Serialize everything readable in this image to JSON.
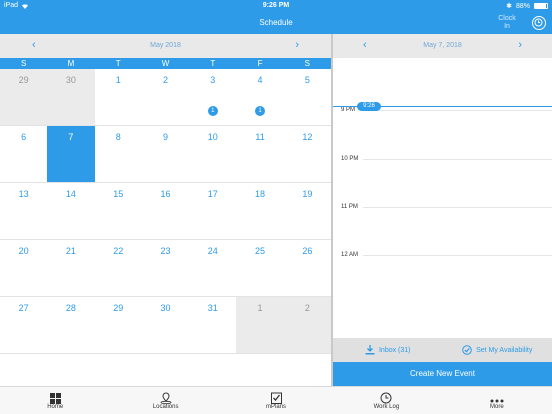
{
  "status": {
    "device": "iPad",
    "time": "9:26 PM",
    "battery": "88%",
    "battery_level": 0.88
  },
  "nav": {
    "title": "Schedule",
    "clock_in": "Clock In"
  },
  "calendar": {
    "month": "May 2018",
    "weekdays": [
      "S",
      "M",
      "T",
      "W",
      "T",
      "F",
      "S"
    ],
    "weeks": [
      [
        {
          "d": "29",
          "other": true
        },
        {
          "d": "30",
          "other": true
        },
        {
          "d": "1"
        },
        {
          "d": "2"
        },
        {
          "d": "3",
          "badge": "1"
        },
        {
          "d": "4",
          "badge": "1"
        },
        {
          "d": "5"
        }
      ],
      [
        {
          "d": "6"
        },
        {
          "d": "7",
          "selected": true
        },
        {
          "d": "8"
        },
        {
          "d": "9"
        },
        {
          "d": "10"
        },
        {
          "d": "11"
        },
        {
          "d": "12"
        }
      ],
      [
        {
          "d": "13"
        },
        {
          "d": "14"
        },
        {
          "d": "15"
        },
        {
          "d": "16"
        },
        {
          "d": "17"
        },
        {
          "d": "18"
        },
        {
          "d": "19"
        }
      ],
      [
        {
          "d": "20"
        },
        {
          "d": "21"
        },
        {
          "d": "22"
        },
        {
          "d": "23"
        },
        {
          "d": "24"
        },
        {
          "d": "25"
        },
        {
          "d": "26"
        }
      ],
      [
        {
          "d": "27"
        },
        {
          "d": "28"
        },
        {
          "d": "29"
        },
        {
          "d": "30"
        },
        {
          "d": "31"
        },
        {
          "d": "1",
          "other": true
        },
        {
          "d": "2",
          "other": true
        }
      ]
    ]
  },
  "dayview": {
    "date": "May 7, 2018",
    "hours": [
      "9 PM",
      "10 PM",
      "11 PM",
      "12 AM"
    ],
    "now": "9:26",
    "inbox": "Inbox (31)",
    "availability": "Set My Availability",
    "create": "Create New Event"
  },
  "tabs": [
    "Home",
    "Locations",
    "mPlans",
    "Work Log",
    "More"
  ],
  "colors": {
    "accent": "#2e9be8"
  }
}
